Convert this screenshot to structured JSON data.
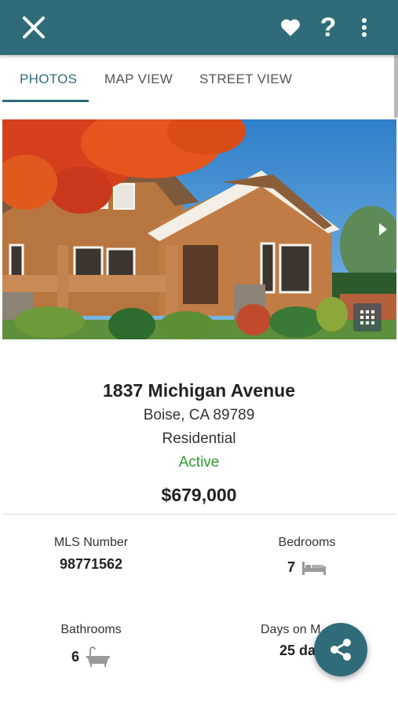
{
  "toolbar": {
    "icons": [
      "close-icon",
      "heart-icon",
      "help-icon",
      "more-vert-icon"
    ],
    "help_glyph": "?",
    "color": "#2f6b78"
  },
  "tabs": [
    {
      "label": "PHOTOS",
      "active": true
    },
    {
      "label": "MAP VIEW",
      "active": false
    },
    {
      "label": "STREET VIEW",
      "active": false
    }
  ],
  "listing": {
    "address": "1837 Michigan Avenue",
    "city_line": "Boise, CA 89789",
    "property_type": "Residential",
    "status": "Active",
    "status_color": "#2e9a2e",
    "price": "$679,000"
  },
  "stats": {
    "mls_label": "MLS Number",
    "mls_value": "98771562",
    "bedrooms_label": "Bedrooms",
    "bedrooms_value": "7",
    "bathrooms_label": "Bathrooms",
    "bathrooms_value": "6",
    "days_label": "Days on M",
    "days_value": "25 da"
  },
  "fab": {
    "icon": "share-icon"
  }
}
